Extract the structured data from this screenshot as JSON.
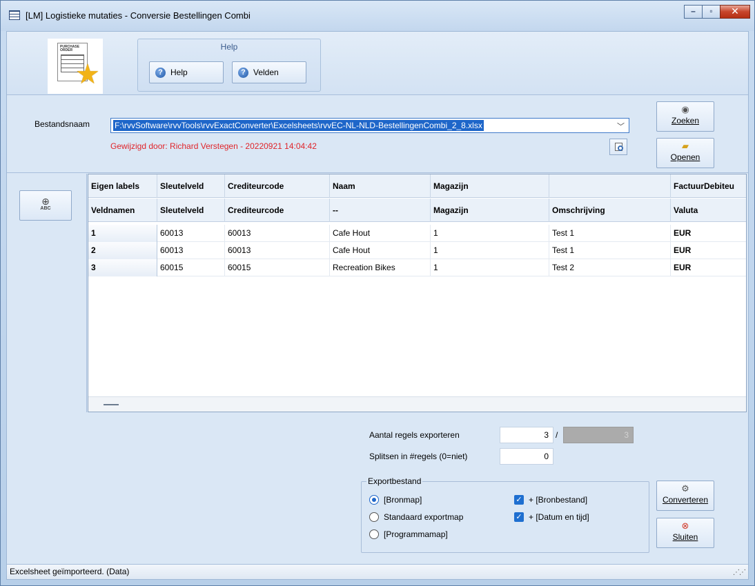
{
  "window": {
    "title": "[LM]  Logistieke mutaties - Conversie Bestellingen Combi"
  },
  "doc_icon": {
    "label": "PURCHASE ORDER",
    "icon": "purchase-order-star-icon"
  },
  "ribbon": {
    "group_title": "Help",
    "help_button": "Help",
    "fields_button": "Velden"
  },
  "file": {
    "label": "Bestandsnaam",
    "path": "F:\\rvvSoftware\\rvvTools\\rvvExactConverter\\Excelsheets\\rvvEC-NL-NLD-BestellingenCombi_2_8.xlsx",
    "modified": "Gewijzigd door: Richard Verstegen  -  20220921  14:04:42"
  },
  "side_buttons": {
    "search": "Zoeken",
    "open": "Openen",
    "convert": "Converteren",
    "close": "Sluiten"
  },
  "grid": {
    "header_row1": [
      "Eigen labels",
      "Sleutelveld",
      "Crediteurcode",
      "Naam",
      "Magazijn",
      "",
      "FactuurDebiteu"
    ],
    "header_row2": [
      "Veldnamen",
      "Sleutelveld",
      "Crediteurcode",
      "--",
      "Magazijn",
      "Omschrijving",
      "Valuta"
    ],
    "rows": [
      [
        "1",
        "60013",
        "60013",
        "Cafe Hout",
        "1",
        "Test 1",
        "EUR"
      ],
      [
        "2",
        "60013",
        "60013",
        "Cafe Hout",
        "1",
        "Test 1",
        "EUR"
      ],
      [
        "3",
        "60015",
        "60015",
        "Recreation Bikes",
        "1",
        "Test 2",
        "EUR"
      ]
    ]
  },
  "export": {
    "rows_label": "Aantal regels exporteren",
    "rows_value": "3",
    "rows_total": "3",
    "slash": "/",
    "split_label": "Splitsen in #regels (0=niet)",
    "split_value": "0",
    "group_title": "Exportbestand",
    "radio_options": [
      "[Bronmap]",
      "Standaard exportmap",
      "[Programmamap]"
    ],
    "selected_radio": 0,
    "checks": [
      "+ [Bronbestand]",
      "+ [Datum en tijd]"
    ]
  },
  "status": {
    "text": "Excelsheet geïmporteerd. (Data)"
  },
  "colors": {
    "accent": "#1e66c9",
    "warning_text": "#e0242a"
  }
}
